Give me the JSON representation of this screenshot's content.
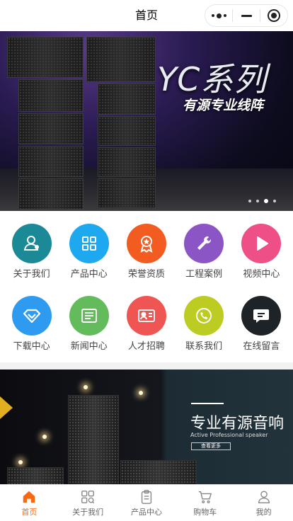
{
  "navbar": {
    "title": "首页"
  },
  "banner": {
    "title": "YC系列",
    "subtitle": "有源专业线阵",
    "slides": 4,
    "active_slide": 3
  },
  "menu": [
    {
      "label": "关于我们",
      "icon": "user-icon",
      "color": "#1c8a96"
    },
    {
      "label": "产品中心",
      "icon": "grid-icon",
      "color": "#1da8ef"
    },
    {
      "label": "荣誉资质",
      "icon": "award-icon",
      "color": "#f35c21"
    },
    {
      "label": "工程案例",
      "icon": "wrench-icon",
      "color": "#8b55c6"
    },
    {
      "label": "视频中心",
      "icon": "play-icon",
      "color": "#ee4f86"
    },
    {
      "label": "下载中心",
      "icon": "download-icon",
      "color": "#2e9bf0"
    },
    {
      "label": "新闻中心",
      "icon": "news-icon",
      "color": "#63bb5b"
    },
    {
      "label": "人才招聘",
      "icon": "id-card-icon",
      "color": "#ef5552"
    },
    {
      "label": "联系我们",
      "icon": "phone-icon",
      "color": "#bccc22"
    },
    {
      "label": "在线留言",
      "icon": "message-icon",
      "color": "#1e2327"
    }
  ],
  "promo": {
    "title": "专业有源音响",
    "subtitle": "Active Professional speaker",
    "button": "查看更多"
  },
  "tabbar": [
    {
      "label": "首页",
      "icon": "home-icon",
      "active": true
    },
    {
      "label": "关于我们",
      "icon": "apps-icon",
      "active": false
    },
    {
      "label": "产品中心",
      "icon": "clipboard-icon",
      "active": false
    },
    {
      "label": "购物车",
      "icon": "cart-icon",
      "active": false
    },
    {
      "label": "我的",
      "icon": "profile-icon",
      "active": false
    }
  ],
  "colors": {
    "accent": "#f76a11",
    "tab_inactive": "#666666"
  }
}
